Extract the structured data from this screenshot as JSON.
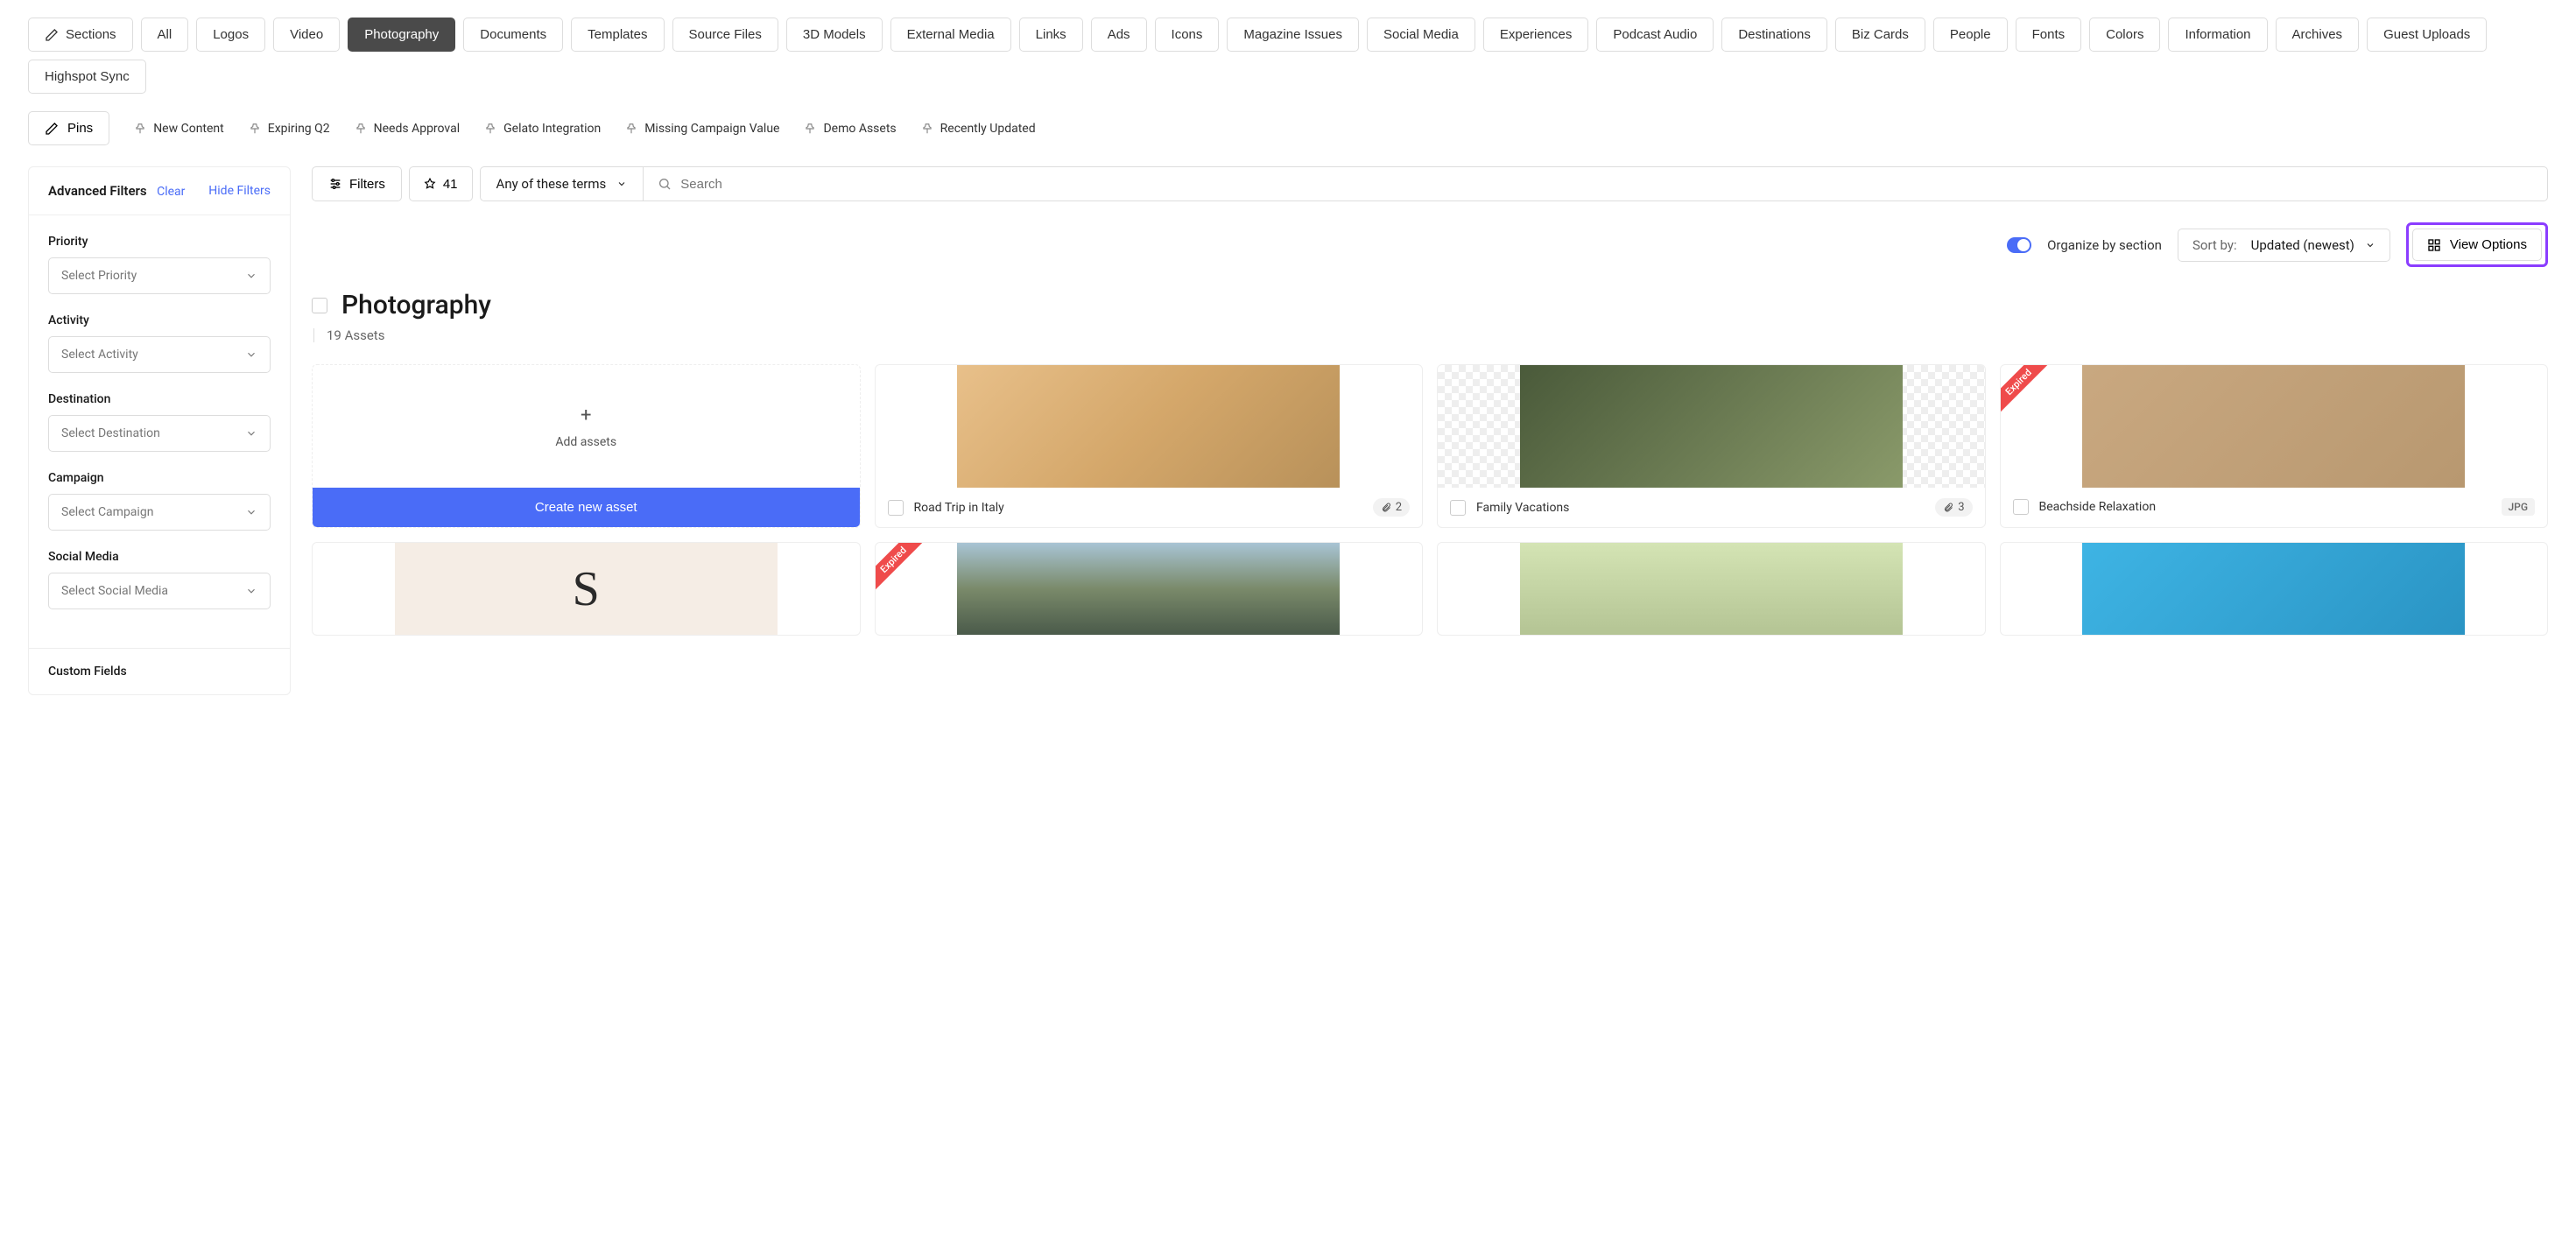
{
  "tags": {
    "sections": "Sections",
    "items": [
      "All",
      "Logos",
      "Video",
      "Photography",
      "Documents",
      "Templates",
      "Source Files",
      "3D Models",
      "External Media",
      "Links",
      "Ads",
      "Icons",
      "Magazine Issues",
      "Social Media",
      "Experiences",
      "Podcast Audio",
      "Destinations",
      "Biz Cards",
      "People",
      "Fonts",
      "Colors",
      "Information",
      "Archives",
      "Guest Uploads",
      "Highspot Sync"
    ],
    "active_index": 3
  },
  "pins": {
    "button": "Pins",
    "items": [
      "New Content",
      "Expiring Q2",
      "Needs Approval",
      "Gelato Integration",
      "Missing Campaign Value",
      "Demo Assets",
      "Recently Updated"
    ]
  },
  "sidebar": {
    "title": "Advanced Filters",
    "clear": "Clear",
    "hide": "Hide Filters",
    "filters": [
      {
        "label": "Priority",
        "placeholder": "Select Priority"
      },
      {
        "label": "Activity",
        "placeholder": "Select Activity"
      },
      {
        "label": "Destination",
        "placeholder": "Select Destination"
      },
      {
        "label": "Campaign",
        "placeholder": "Select Campaign"
      },
      {
        "label": "Social Media",
        "placeholder": "Select Social Media"
      }
    ],
    "custom_fields": "Custom Fields"
  },
  "filterbar": {
    "filters": "Filters",
    "pin_count": "41",
    "term_mode": "Any of these terms",
    "search_placeholder": "Search"
  },
  "controls": {
    "organize": "Organize by section",
    "sort_label": "Sort by:",
    "sort_value": "Updated (newest)",
    "view_options": "View Options"
  },
  "section": {
    "title": "Photography",
    "count": "19 Assets",
    "add_assets": "Add assets",
    "create_new": "Create new asset"
  },
  "assets": [
    {
      "title": "Road Trip in Italy",
      "attachments": "2",
      "bg": "bg-warm"
    },
    {
      "title": "Family Vacations",
      "attachments": "3",
      "bg": "checker",
      "expired": false,
      "inner_bg": "bg-couple"
    },
    {
      "title": "Beachside Relaxation",
      "format": "JPG",
      "bg": "bg-beach",
      "expired": true
    }
  ],
  "row2": [
    {
      "bg": "bg-s"
    },
    {
      "bg": "bg-mtn",
      "expired": true
    },
    {
      "bg": "bg-bike"
    },
    {
      "bg": "bg-pool"
    }
  ],
  "labels": {
    "expired": "Expired"
  }
}
